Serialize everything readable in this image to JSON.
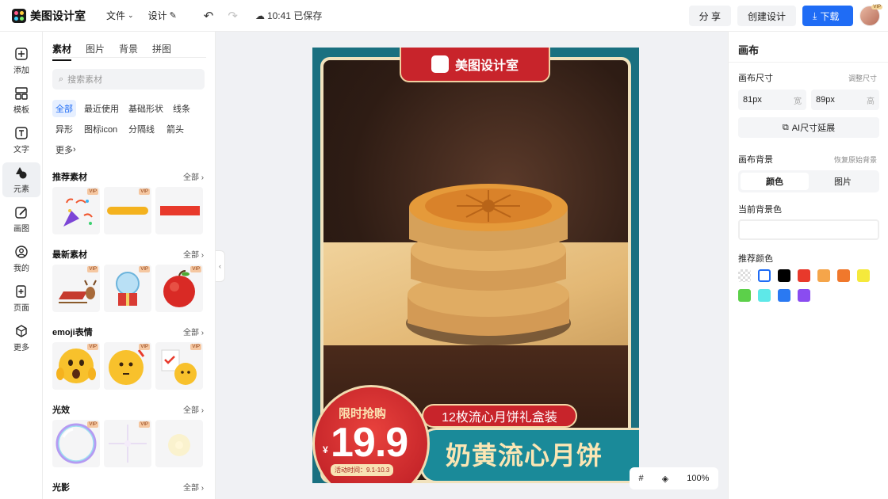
{
  "topbar": {
    "app_name": "美图设计室",
    "menu": {
      "file": "文件",
      "design": "设计"
    },
    "saved": "10:41 已保存",
    "share": "分 享",
    "create": "创建设计",
    "download": "下载",
    "avatar_badge": "VIP"
  },
  "rail": [
    {
      "label": "添加",
      "icon": "plus-square-icon"
    },
    {
      "label": "模板",
      "icon": "template-icon"
    },
    {
      "label": "文字",
      "icon": "text-icon"
    },
    {
      "label": "元素",
      "icon": "shapes-icon"
    },
    {
      "label": "画图",
      "icon": "pencil-icon"
    },
    {
      "label": "我的",
      "icon": "user-icon"
    },
    {
      "label": "页面",
      "icon": "page-add-icon"
    },
    {
      "label": "更多",
      "icon": "cube-icon"
    }
  ],
  "panel": {
    "tabs": [
      "素材",
      "图片",
      "背景",
      "拼图"
    ],
    "search_placeholder": "搜索素材",
    "chips": [
      "全部",
      "最近使用",
      "基础形状",
      "线条",
      "异形",
      "图标icon",
      "分隔线",
      "箭头",
      "更多"
    ],
    "all_label": "全部",
    "vip": "VIP",
    "sections": [
      "推荐素材",
      "最新素材",
      "emoji表情",
      "光效",
      "光影"
    ]
  },
  "poster": {
    "brand": "美图设计室",
    "ribbon": "12枚流心月饼礼盒装",
    "product": "奶黄流心月饼",
    "promo_label": "限时抢购",
    "currency": "¥",
    "price": "19.9",
    "date": "活动时间：9.1-10.3"
  },
  "zoom": {
    "level": "100%"
  },
  "right": {
    "title": "画布",
    "size_label": "画布尺寸",
    "adjust": "调整尺寸",
    "width_value": "81px",
    "width_unit": "宽",
    "height_value": "89px",
    "height_unit": "高",
    "ai_button": "AI尺寸延展",
    "bg_label": "画布背景",
    "restore": "恢复原始背景",
    "seg_color": "颜色",
    "seg_image": "图片",
    "current_bg": "当前背景色",
    "recommend": "推荐颜色",
    "swatches": [
      "#ffffff",
      "#000000",
      "#e8392b",
      "#f5a54a",
      "#f0782c",
      "#f5e93c",
      "#5cd04a",
      "#5ee8e8",
      "#2a79f2",
      "#8a4cf0"
    ]
  }
}
